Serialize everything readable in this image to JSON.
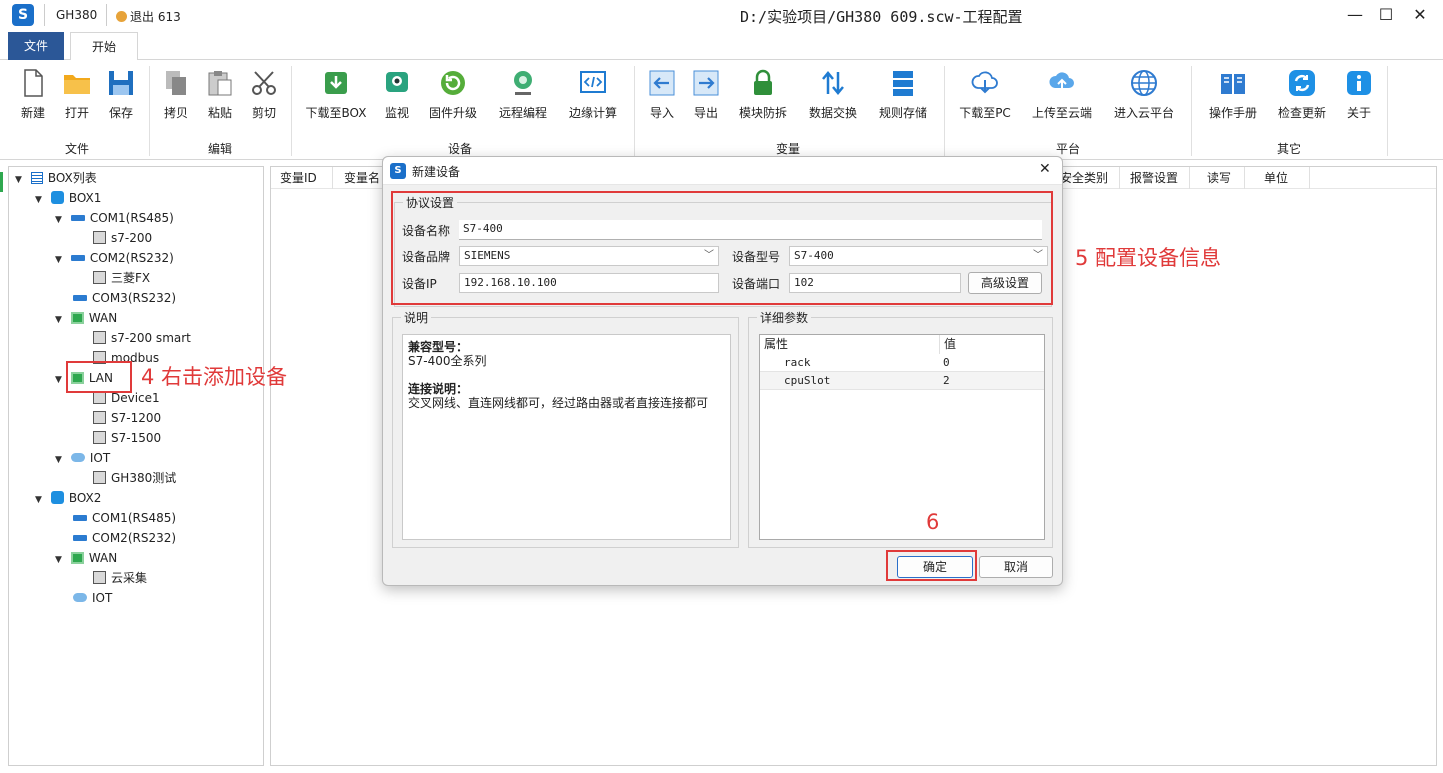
{
  "app": {
    "logo_letter": "S",
    "project_name": "GH380",
    "logout_label": "退出 613",
    "window_title": "D:/实验项目/GH380 609.scw-工程配置",
    "minimize_glyph": "—",
    "maximize_glyph": "☐",
    "close_glyph": "✕"
  },
  "tabs": {
    "file": "文件",
    "start": "开始"
  },
  "ribbon": {
    "groups": {
      "file": "文件",
      "edit": "编辑",
      "device": "设备",
      "variable": "变量",
      "platform": "平台",
      "other": "其它"
    },
    "buttons": {
      "new": "新建",
      "open": "打开",
      "save": "保存",
      "copy": "拷贝",
      "paste": "粘贴",
      "cut": "剪切",
      "download_box": "下载至BOX",
      "monitor": "监视",
      "firmware": "固件升级",
      "remote": "远程编程",
      "edge": "边缘计算",
      "import": "导入",
      "export": "导出",
      "anti_dismantle": "模块防拆",
      "data_exchange": "数据交换",
      "rule_storage": "规则存储",
      "download_pc": "下载至PC",
      "upload_cloud": "上传至云端",
      "enter_cloud": "进入云平台",
      "manual": "操作手册",
      "check_update": "检查更新",
      "about": "关于"
    }
  },
  "tree": {
    "root": "BOX列表",
    "box1": "BOX1",
    "com1": "COM1(RS485)",
    "s7200": "s7-200",
    "com2": "COM2(RS232)",
    "mitsubishi": "三菱FX",
    "com3": "COM3(RS232)",
    "wan": "WAN",
    "s7200smart": "s7-200 smart",
    "modbus": "modbus",
    "lan": "LAN",
    "device1": "Device1",
    "s71200": "S7-1200",
    "s71500": "S7-1500",
    "iot": "IOT",
    "gh380test": "GH380测试",
    "box2": "BOX2",
    "box2_com1": "COM1(RS485)",
    "box2_com2": "COM2(RS232)",
    "box2_wan": "WAN",
    "cloud_collect": "云采集",
    "box2_iot": "IOT"
  },
  "grid": {
    "columns": {
      "var_id": "变量ID",
      "var_name": "变量名",
      "security": "安全类别",
      "alarm": "报警设置",
      "rw": "读写",
      "unit": "单位"
    }
  },
  "annotations": {
    "step4": "4 右击添加设备",
    "step5": "5 配置设备信息",
    "step6": "6"
  },
  "dialog": {
    "logo_letter": "S",
    "title": "新建设备",
    "close": "✕",
    "protocol_legend": "协议设置",
    "name_label": "设备名称",
    "name_value": "S7-400",
    "brand_label": "设备品牌",
    "brand_value": "SIEMENS",
    "model_label": "设备型号",
    "model_value": "S7-400",
    "ip_label": "设备IP",
    "ip_value": "192.168.10.100",
    "port_label": "设备端口",
    "port_value": "102",
    "advanced_button": "高级设置",
    "desc_legend": "说明",
    "desc_compat_title": "兼容型号：",
    "desc_compat_value": "S7-400全系列",
    "desc_conn_title": "连接说明：",
    "desc_conn_value": "交叉网线、直连网线都可，经过路由器或者直接连接都可",
    "params_legend": "详细参数",
    "params_header": {
      "property": "属性",
      "value": "值"
    },
    "params": [
      {
        "name": "rack",
        "value": "0"
      },
      {
        "name": "cpuSlot",
        "value": "2"
      }
    ],
    "ok_button": "确定",
    "cancel_button": "取消"
  },
  "colors": {
    "accent": "#2b5797",
    "annotation": "#e03a3a",
    "logo": "#1a6fc9"
  }
}
